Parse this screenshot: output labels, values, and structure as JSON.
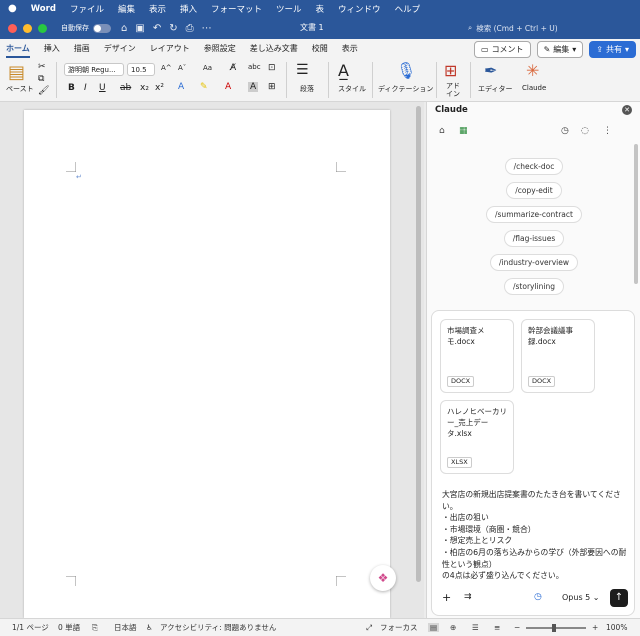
{
  "menubar": {
    "apple": "",
    "app": "Word",
    "items": [
      "ファイル",
      "編集",
      "表示",
      "挿入",
      "フォーマット",
      "ツール",
      "表",
      "ウィンドウ",
      "ヘルプ"
    ]
  },
  "titlebar": {
    "autosave_label": "自動保存",
    "doc_title": "文書 1",
    "search_placeholder": "検索 (Cmd + Ctrl + U)"
  },
  "tabs": [
    "ホーム",
    "挿入",
    "描画",
    "デザイン",
    "レイアウト",
    "参照設定",
    "差し込み文書",
    "校閲",
    "表示"
  ],
  "active_tab": "ホーム",
  "tab_actions": {
    "comment": "コメント",
    "edit": "編集",
    "share": "共有"
  },
  "ribbon": {
    "paste": "ペースト",
    "font_name": "游明朝 Regu...",
    "font_size": "10.5",
    "grow": "A^",
    "shrink": "Aˇ",
    "case": "Aa",
    "paragraph": "段落",
    "styles": "スタイル",
    "dictation": "ディクテーション",
    "addins": "アド\nイン",
    "editor": "エディター",
    "claude": "Claude"
  },
  "panel": {
    "title": "Claude",
    "commands": [
      "/check-doc",
      "/copy-edit",
      "/summarize-contract",
      "/flag-issues",
      "/industry-overview",
      "/storylining"
    ],
    "files": [
      {
        "name": "市場調査メモ.docx",
        "ext": "DOCX"
      },
      {
        "name": "幹部会議議事録.docx",
        "ext": "DOCX"
      },
      {
        "name": "ハレノヒベーカリー_売上データ.xlsx",
        "ext": "XLSX"
      }
    ],
    "message": "大宮店の新規出店提案書のたたき台を書いてください。\n・出店の狙い\n・市場環境（商圏・競合）\n・想定売上とリスク\n・柏店の6月の落ち込みからの学び（外部要因への耐性という観点）\nの4点は必ず盛り込んでください。",
    "model": "Opus 5"
  },
  "statusbar": {
    "page": "1/1 ページ",
    "words": "0 単語",
    "language": "日本語",
    "accessibility": "アクセシビリティ: 問題ありません",
    "focus": "フォーカス",
    "zoom": "100%"
  },
  "colors": {
    "brand": "#2b579a",
    "share": "#2b6cd4",
    "send": "#1d1d1d"
  }
}
